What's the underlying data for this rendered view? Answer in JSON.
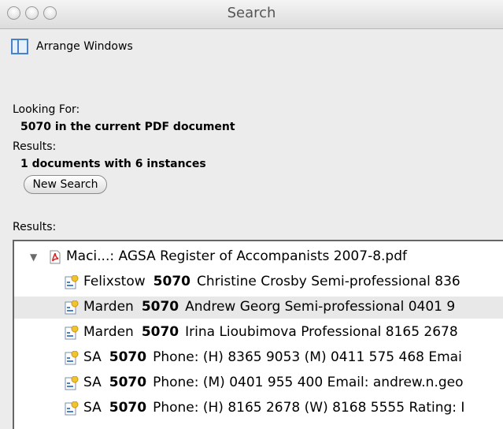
{
  "window": {
    "title": "Search"
  },
  "arrange_label": "Arrange Windows",
  "looking_for": {
    "label": "Looking For:",
    "value": "5070 in the current PDF document"
  },
  "summary": {
    "label": "Results:",
    "value": "1 documents with 6 instances"
  },
  "new_search_label": "New Search",
  "results_label": "Results:",
  "document": {
    "name": "Maci...: AGSA Register of Accompanists 2007-8.pdf",
    "expanded": true
  },
  "hits": [
    {
      "pre": "Felixstow",
      "num": "5070",
      "post": "Christine Crosby Semi-professional 836",
      "selected": false
    },
    {
      "pre": "Marden",
      "num": "5070",
      "post": "Andrew Georg Semi-professional 0401 9",
      "selected": true
    },
    {
      "pre": "Marden",
      "num": "5070",
      "post": "Irina Lioubimova Professional 8165 2678",
      "selected": false
    },
    {
      "pre": "SA",
      "num": "5070",
      "post": "Phone: (H) 8365 9053 (M) 0411 575 468 Emai",
      "selected": false
    },
    {
      "pre": "SA",
      "num": "5070",
      "post": "Phone: (M) 0401 955 400 Email: andrew.n.geo",
      "selected": false
    },
    {
      "pre": "SA",
      "num": "5070",
      "post": "Phone: (H) 8165 2678 (W) 8168 5555 Rating: I",
      "selected": false
    }
  ],
  "colors": {
    "window_bg": "#ececec",
    "accent": "#4a82c9",
    "selection": "#e8e8e8"
  }
}
